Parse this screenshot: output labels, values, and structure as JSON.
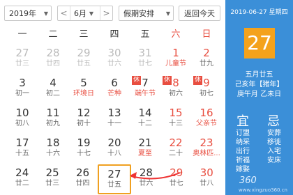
{
  "toolbar": {
    "year": "2019年",
    "month": "6月",
    "holiday": "假期安排",
    "today": "返回今天",
    "prev": "<",
    "next": ">"
  },
  "weekdays": [
    "一",
    "二",
    "三",
    "四",
    "五",
    "六",
    "日"
  ],
  "weeks": [
    [
      {
        "num": "27",
        "sub": "廿三",
        "other": true
      },
      {
        "num": "28",
        "sub": "廿四",
        "other": true
      },
      {
        "num": "29",
        "sub": "廿五",
        "other": true
      },
      {
        "num": "30",
        "sub": "廿六",
        "other": true
      },
      {
        "num": "31",
        "sub": "廿七",
        "other": true
      },
      {
        "num": "1",
        "sub": "儿童节",
        "subRed": true,
        "weekend": true
      },
      {
        "num": "2",
        "sub": "廿九",
        "weekend": true
      }
    ],
    [
      {
        "num": "3",
        "sub": "初一"
      },
      {
        "num": "4",
        "sub": "初二"
      },
      {
        "num": "5",
        "sub": "环境日",
        "subRed": true
      },
      {
        "num": "6",
        "sub": "芒种",
        "subRed": true
      },
      {
        "num": "7",
        "sub": "端午节",
        "subRed": true,
        "badge": "休"
      },
      {
        "num": "8",
        "sub": "初六",
        "weekend": true,
        "badge": "休"
      },
      {
        "num": "9",
        "sub": "初七",
        "weekend": true,
        "badge": "休"
      }
    ],
    [
      {
        "num": "10",
        "sub": "初八"
      },
      {
        "num": "11",
        "sub": "初九"
      },
      {
        "num": "12",
        "sub": "初十"
      },
      {
        "num": "13",
        "sub": "十一"
      },
      {
        "num": "14",
        "sub": "十二"
      },
      {
        "num": "15",
        "sub": "十三",
        "weekend": true
      },
      {
        "num": "16",
        "sub": "父亲节",
        "subRed": true,
        "weekend": true
      }
    ],
    [
      {
        "num": "17",
        "sub": "十五"
      },
      {
        "num": "18",
        "sub": "十六"
      },
      {
        "num": "19",
        "sub": "十七"
      },
      {
        "num": "20",
        "sub": "十八"
      },
      {
        "num": "21",
        "sub": "夏至",
        "subRed": true
      },
      {
        "num": "22",
        "sub": "二十",
        "weekend": true
      },
      {
        "num": "23",
        "sub": "奥林匹...",
        "subRed": true,
        "weekend": true
      }
    ],
    [
      {
        "num": "24",
        "sub": "廿二"
      },
      {
        "num": "25",
        "sub": "廿三"
      },
      {
        "num": "26",
        "sub": "廿四"
      },
      {
        "num": "27",
        "sub": "廿五",
        "selected": true
      },
      {
        "num": "28",
        "sub": "廿六"
      },
      {
        "num": "29",
        "sub": "廿七",
        "weekend": true
      },
      {
        "num": "30",
        "sub": "廿八",
        "weekend": true
      }
    ]
  ],
  "panel": {
    "date": "2019-06-27 星期四",
    "day": "27",
    "lunar1": "五月廿五",
    "lunar2": "己亥年【猪年】",
    "lunar3": "庚午月 乙未日",
    "yi": "宜",
    "ji": "忌",
    "yi_list": [
      "订盟",
      "纳采",
      "出行",
      "祈福",
      "嫁娶"
    ],
    "ji_list": [
      "安葬",
      "移徙",
      "入宅",
      "安床"
    ]
  },
  "watermark": {
    "line1": "360",
    "line2": "www.xingzuo360.cn"
  },
  "colors": {
    "accent": "#3b8fd8",
    "highlight": "#f4a21c",
    "weekend": "#e84e40",
    "selected_border": "#f0a020"
  }
}
